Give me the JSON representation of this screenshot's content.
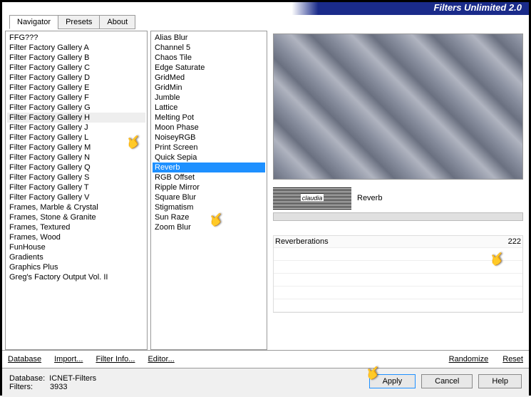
{
  "app_title": "Filters Unlimited 2.0",
  "tabs": [
    "Navigator",
    "Presets",
    "About"
  ],
  "categories": [
    "FFG???",
    "Filter Factory Gallery A",
    "Filter Factory Gallery B",
    "Filter Factory Gallery C",
    "Filter Factory Gallery D",
    "Filter Factory Gallery E",
    "Filter Factory Gallery F",
    "Filter Factory Gallery G",
    "Filter Factory Gallery H",
    "Filter Factory Gallery J",
    "Filter Factory Gallery L",
    "Filter Factory Gallery M",
    "Filter Factory Gallery N",
    "Filter Factory Gallery Q",
    "Filter Factory Gallery S",
    "Filter Factory Gallery T",
    "Filter Factory Gallery V",
    "Frames, Marble & Crystal",
    "Frames, Stone & Granite",
    "Frames, Textured",
    "Frames, Wood",
    "FunHouse",
    "Gradients",
    "Graphics Plus",
    "Greg's Factory Output Vol. II"
  ],
  "selected_category_index": 8,
  "filters": [
    "Alias Blur",
    "Channel 5",
    "Chaos Tile",
    "Edge Saturate",
    "GridMed",
    "GridMin",
    "Jumble",
    "Lattice",
    "Melting Pot",
    "Moon Phase",
    "NoiseyRGB",
    "Print Screen",
    "Quick Sepia",
    "Reverb",
    "RGB Offset",
    "Ripple Mirror",
    "Square Blur",
    "Stigmatism",
    "Sun Raze",
    "Zoom Blur"
  ],
  "selected_filter_index": 13,
  "current_filter": "Reverb",
  "logo_text": "claudia",
  "params": [
    {
      "name": "Reverberations",
      "value": "222"
    }
  ],
  "toolbar": {
    "database": "Database",
    "import": "Import...",
    "filter_info": "Filter Info...",
    "editor": "Editor...",
    "randomize": "Randomize",
    "reset": "Reset"
  },
  "footer": {
    "db_label": "Database:",
    "db_value": "ICNET-Filters",
    "filters_label": "Filters:",
    "filters_value": "3933",
    "apply": "Apply",
    "cancel": "Cancel",
    "help": "Help"
  }
}
